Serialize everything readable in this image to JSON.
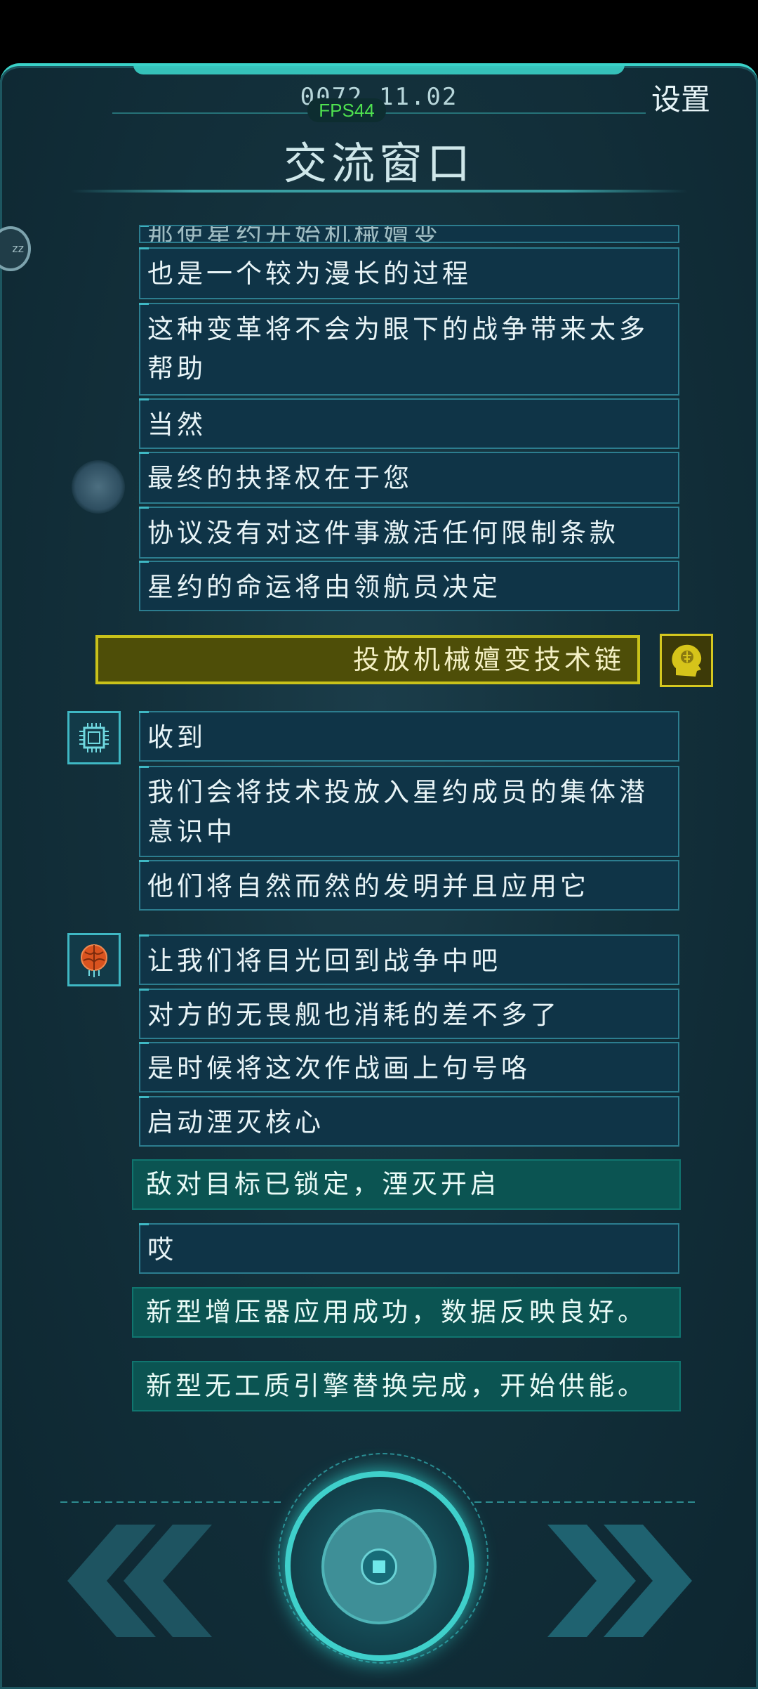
{
  "header": {
    "date": "0072 11.02",
    "fps": "FPS44",
    "settings_label": "设置",
    "title": "交流窗口",
    "side_badge": "zz"
  },
  "messages": {
    "partial": "那使星约开始机械嬗变",
    "m1": "也是一个较为漫长的过程",
    "m2": "这种变革将不会为眼下的战争带来太多帮助",
    "m3": "当然",
    "m4": "最终的抉择权在于您",
    "m5": "协议没有对这件事激活任何限制条款",
    "m6": "星约的命运将由领航员决定",
    "player": "投放机械嬗变技术链",
    "ai1": "收到",
    "ai2": "我们会将技术投放入星约成员的集体潜意识中",
    "ai3": "他们将自然而然的发明并且应用它",
    "b1": "让我们将目光回到战争中吧",
    "b2": "对方的无畏舰也消耗的差不多了",
    "b3": "是时候将这次作战画上句号咯",
    "b4": "启动湮灭核心",
    "sys1": "敌对目标已锁定，湮灭开启",
    "m7": "哎",
    "sys2": "新型增压器应用成功，数据反映良好。",
    "sys3": "新型无工质引擎替换完成，开始供能。"
  },
  "colors": {
    "accent": "#3ad2c8",
    "player_bubble": "#4e4e08",
    "player_border": "#c9c21a",
    "system_bubble": "#0b5452",
    "message_bubble": "#0f3447"
  },
  "icons": {
    "ai": "ai-chip-icon",
    "brain": "brain-icon",
    "player": "head-brain-icon",
    "stop": "stop-icon",
    "prev": "double-chevron-left-icon",
    "next": "double-chevron-right-icon"
  }
}
